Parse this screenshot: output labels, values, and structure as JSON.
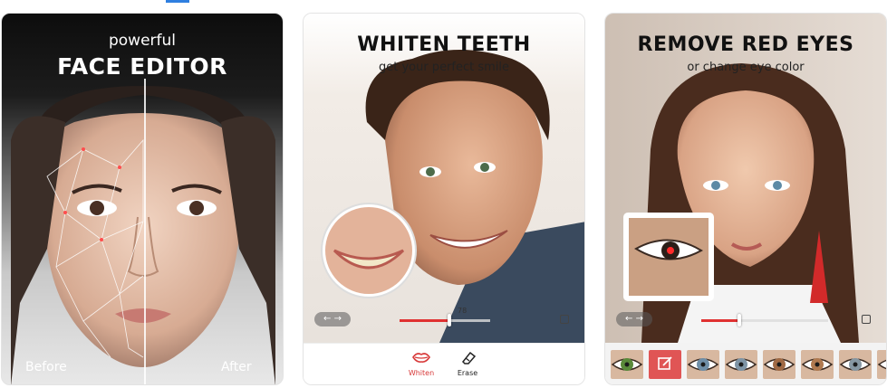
{
  "screens": [
    {
      "tagline": "powerful",
      "title": "FACE EDITOR",
      "before_label": "Before",
      "after_label": "After"
    },
    {
      "title": "WHITEN TEETH",
      "subtitle": "get your perfect smile",
      "slider": {
        "value_text": "78",
        "level": 0.55
      },
      "tools": [
        {
          "label": "Whiten",
          "icon": "lips-icon",
          "active": true
        },
        {
          "label": "Erase",
          "icon": "eraser-icon",
          "active": false
        }
      ]
    },
    {
      "title": "REMOVE RED EYES",
      "subtitle": "or change eye color",
      "slider": {
        "level": 0.3
      },
      "swatches": [
        {
          "icon": "green-eye-swatch",
          "color": "#5a8a3a"
        },
        {
          "icon": "edit-icon",
          "color": "#e05555"
        },
        {
          "icon": "blue-eye-swatch",
          "color": "#6f8fa8"
        },
        {
          "icon": "gray-blue-eye-swatch",
          "color": "#7f95a6"
        },
        {
          "icon": "hazel-eye-swatch",
          "color": "#a06a45"
        },
        {
          "icon": "amber-eye-swatch",
          "color": "#b07a50"
        },
        {
          "icon": "gray-eye-swatch",
          "color": "#8697a2"
        },
        {
          "icon": "dark-blue-eye-swatch",
          "color": "#5e7f9a"
        }
      ]
    }
  ],
  "accent_color": "#e03131"
}
